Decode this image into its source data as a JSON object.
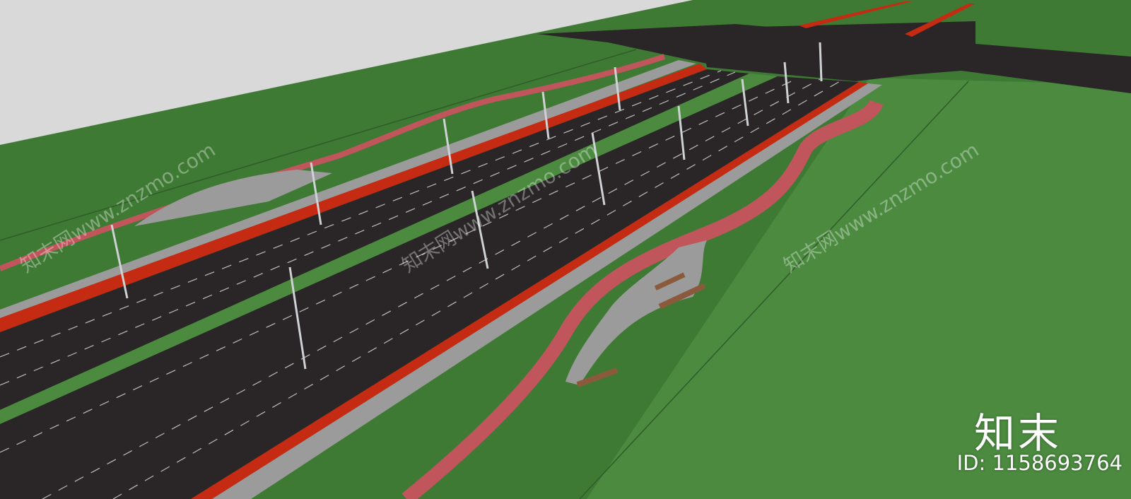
{
  "colors": {
    "sky": "#d9d9d9",
    "grass": "#3f7a35",
    "grass_light": "#4b8a3f",
    "asphalt": "#2a2628",
    "bike_lane": "#c52a12",
    "path_pink": "#c0555c",
    "sidewalk": "#9b9b9b",
    "pole": "#cfd2d4"
  },
  "watermarks": {
    "text": "知末网www.znzmo.com"
  },
  "brand": {
    "logo": "知末",
    "id_text": "ID: 1158693764"
  }
}
